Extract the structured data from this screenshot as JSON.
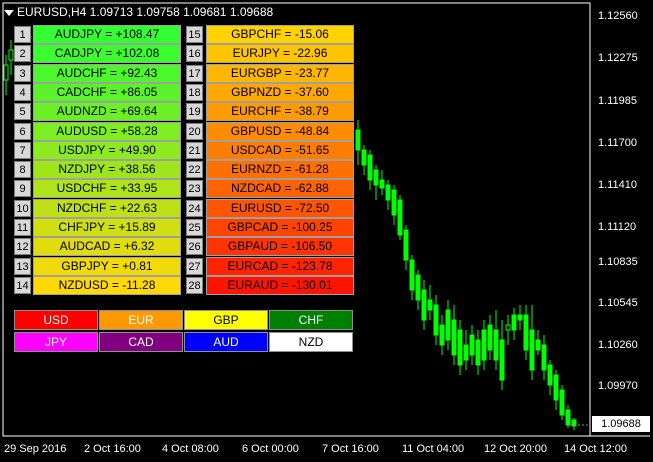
{
  "title": "EURUSD,H4  1.09713 1.09758 1.09681 1.09688",
  "price_axis": [
    "1.12560",
    "1.12275",
    "1.11985",
    "1.11700",
    "1.11410",
    "1.11120",
    "1.10835",
    "1.10545",
    "1.10260",
    "1.09970"
  ],
  "current_price": "1.09688",
  "time_axis": [
    "29 Sep 2016",
    "2 Oct 16:00",
    "4 Oct 08:00",
    "6 Oct 00:00",
    "7 Oct 16:00",
    "11 Oct 04:00",
    "12 Oct 20:00",
    "14 Oct 12:00"
  ],
  "ranking_left": [
    {
      "n": "1",
      "label": "AUDJPY = +108.47",
      "color": "#33ff33"
    },
    {
      "n": "2",
      "label": "CADJPY = +102.08",
      "color": "#3cfd30"
    },
    {
      "n": "3",
      "label": "AUDCHF = +92.43",
      "color": "#4cf72c"
    },
    {
      "n": "4",
      "label": "CADCHF = +86.05",
      "color": "#5af32a"
    },
    {
      "n": "5",
      "label": "AUDNZD = +69.64",
      "color": "#6bef26"
    },
    {
      "n": "6",
      "label": "AUDUSD = +58.28",
      "color": "#7cee22"
    },
    {
      "n": "7",
      "label": "USDJPY = +49.90",
      "color": "#8cea1e"
    },
    {
      "n": "8",
      "label": "NZDJPY = +38.56",
      "color": "#9ee61b"
    },
    {
      "n": "9",
      "label": "USDCHF = +33.95",
      "color": "#afe418"
    },
    {
      "n": "10",
      "label": "NZDCHF = +22.63",
      "color": "#bfe016"
    },
    {
      "n": "11",
      "label": "CHFJPY = +15.89",
      "color": "#cfdf12"
    },
    {
      "n": "12",
      "label": "AUDCAD = +6.32",
      "color": "#e0dc0e"
    },
    {
      "n": "13",
      "label": "GBPJPY = +0.81",
      "color": "#f0da0a"
    },
    {
      "n": "14",
      "label": "NZDUSD = -11.28",
      "color": "#ffd808"
    }
  ],
  "ranking_right": [
    {
      "n": "15",
      "label": "GBPCHF = -15.06",
      "color": "#ffd200"
    },
    {
      "n": "16",
      "label": "EURJPY = -22.96",
      "color": "#ffc400"
    },
    {
      "n": "17",
      "label": "EURGBP = -23.77",
      "color": "#ffb600"
    },
    {
      "n": "18",
      "label": "GBPNZD = -37.60",
      "color": "#ffa800"
    },
    {
      "n": "19",
      "label": "EURCHF = -38.79",
      "color": "#ff9a00"
    },
    {
      "n": "20",
      "label": "GBPUSD = -48.84",
      "color": "#ff8c00"
    },
    {
      "n": "21",
      "label": "USDCAD = -51.65",
      "color": "#ff7e00"
    },
    {
      "n": "22",
      "label": "EURNZD = -61.28",
      "color": "#ff7000"
    },
    {
      "n": "23",
      "label": "NZDCAD = -62.88",
      "color": "#ff6200"
    },
    {
      "n": "24",
      "label": "EURUSD = -72.50",
      "color": "#ff5400"
    },
    {
      "n": "25",
      "label": "GBPCAD = -100.25",
      "color": "#ff4400"
    },
    {
      "n": "26",
      "label": "GBPAUD = -106.50",
      "color": "#ff3400"
    },
    {
      "n": "27",
      "label": "EURCAD = -123.78",
      "color": "#ff2400"
    },
    {
      "n": "28",
      "label": "EURAUD = -130.01",
      "color": "#ff1400"
    }
  ],
  "currency_buttons": [
    {
      "label": "USD",
      "bg": "#ff0000",
      "fg": "#ffffff"
    },
    {
      "label": "EUR",
      "bg": "#ff9900",
      "fg": "#ffffff"
    },
    {
      "label": "GBP",
      "bg": "#ffff00",
      "fg": "#000000"
    },
    {
      "label": "CHF",
      "bg": "#008000",
      "fg": "#ffffff"
    },
    {
      "label": "JPY",
      "bg": "#ff00ff",
      "fg": "#ffffff"
    },
    {
      "label": "CAD",
      "bg": "#800080",
      "fg": "#ffffff"
    },
    {
      "label": "AUD",
      "bg": "#0000ff",
      "fg": "#ffffff"
    },
    {
      "label": "NZD",
      "bg": "#ffffff",
      "fg": "#000000"
    }
  ],
  "colors": {
    "background": "#000000",
    "candle": "#00ff00",
    "axis": "#ffffff"
  }
}
